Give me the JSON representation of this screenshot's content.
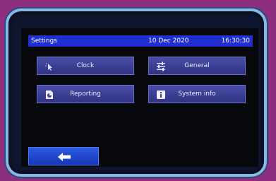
{
  "header": {
    "title": "Settings",
    "date": "10 Dec 2020",
    "time": "16:30:30"
  },
  "buttons": {
    "clock": "Clock",
    "general": "General",
    "reporting": "Reporting",
    "system_info": "System info"
  },
  "icons": {
    "clock": "cursor-icon",
    "general": "sliders-icon",
    "reporting": "report-icon",
    "system_info": "info-icon",
    "back": "back-arrow-icon"
  },
  "colors": {
    "title_bar": "#1f2fd0",
    "button": "#3d4196",
    "back_button": "#2b5ae0",
    "bezel_border": "#8ab8e6",
    "background": "#8e2e7e"
  }
}
